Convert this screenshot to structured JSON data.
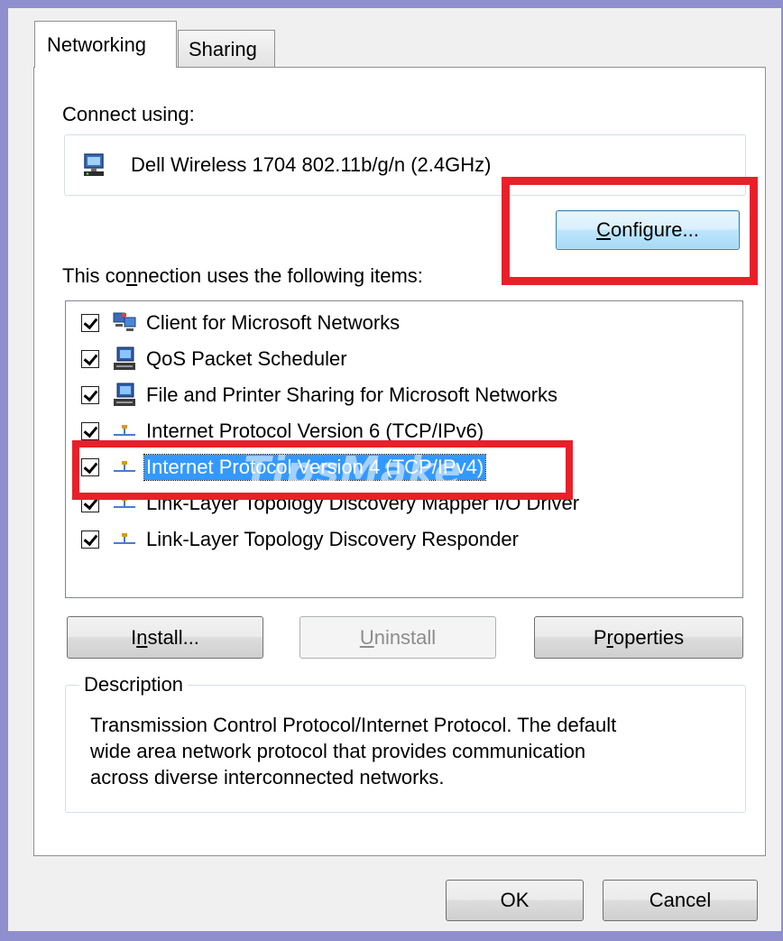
{
  "tabs": [
    {
      "label": "Networking",
      "active": true
    },
    {
      "label": "Sharing",
      "active": false
    }
  ],
  "connect_using_label": "Connect using:",
  "adapter": {
    "name": "Dell Wireless 1704 802.11b/g/n (2.4GHz)",
    "icon": "network-adapter-icon"
  },
  "configure_button": {
    "pre": "",
    "accel": "C",
    "post": "onfigure..."
  },
  "items_label": {
    "pre": "This co",
    "accel": "n",
    "post": "nection uses the following items:"
  },
  "items": [
    {
      "label": "Client for Microsoft Networks",
      "checked": true,
      "icon": "network-client-icon",
      "selected": false
    },
    {
      "label": "QoS Packet Scheduler",
      "checked": true,
      "icon": "network-service-icon",
      "selected": false
    },
    {
      "label": "File and Printer Sharing for Microsoft Networks",
      "checked": true,
      "icon": "network-service-icon",
      "selected": false
    },
    {
      "label": "Internet Protocol Version 6 (TCP/IPv6)",
      "checked": true,
      "icon": "protocol-icon",
      "selected": false
    },
    {
      "label": "Internet Protocol Version 4 (TCP/IPv4)",
      "checked": true,
      "icon": "protocol-icon",
      "selected": true
    },
    {
      "label": "Link-Layer Topology Discovery Mapper I/O Driver",
      "checked": true,
      "icon": "protocol-icon",
      "selected": false
    },
    {
      "label": "Link-Layer Topology Discovery Responder",
      "checked": true,
      "icon": "protocol-icon",
      "selected": false
    }
  ],
  "install_button": {
    "pre": "I",
    "accel": "n",
    "post": "stall..."
  },
  "uninstall_button": {
    "pre": "",
    "accel": "U",
    "post": "ninstall",
    "disabled": true
  },
  "properties_button": {
    "pre": "P",
    "accel": "r",
    "post": "operties"
  },
  "description": {
    "legend": "Description",
    "lines": [
      "Transmission Control Protocol/Internet Protocol. The default",
      "wide area network protocol that provides communication",
      "across diverse interconnected networks."
    ]
  },
  "ok_button": "OK",
  "cancel_button": "Cancel",
  "watermark": "TipsMake",
  "colors": {
    "highlight": "#e8202a",
    "selection": "#3399ff",
    "frame": "#8f8fcf"
  }
}
